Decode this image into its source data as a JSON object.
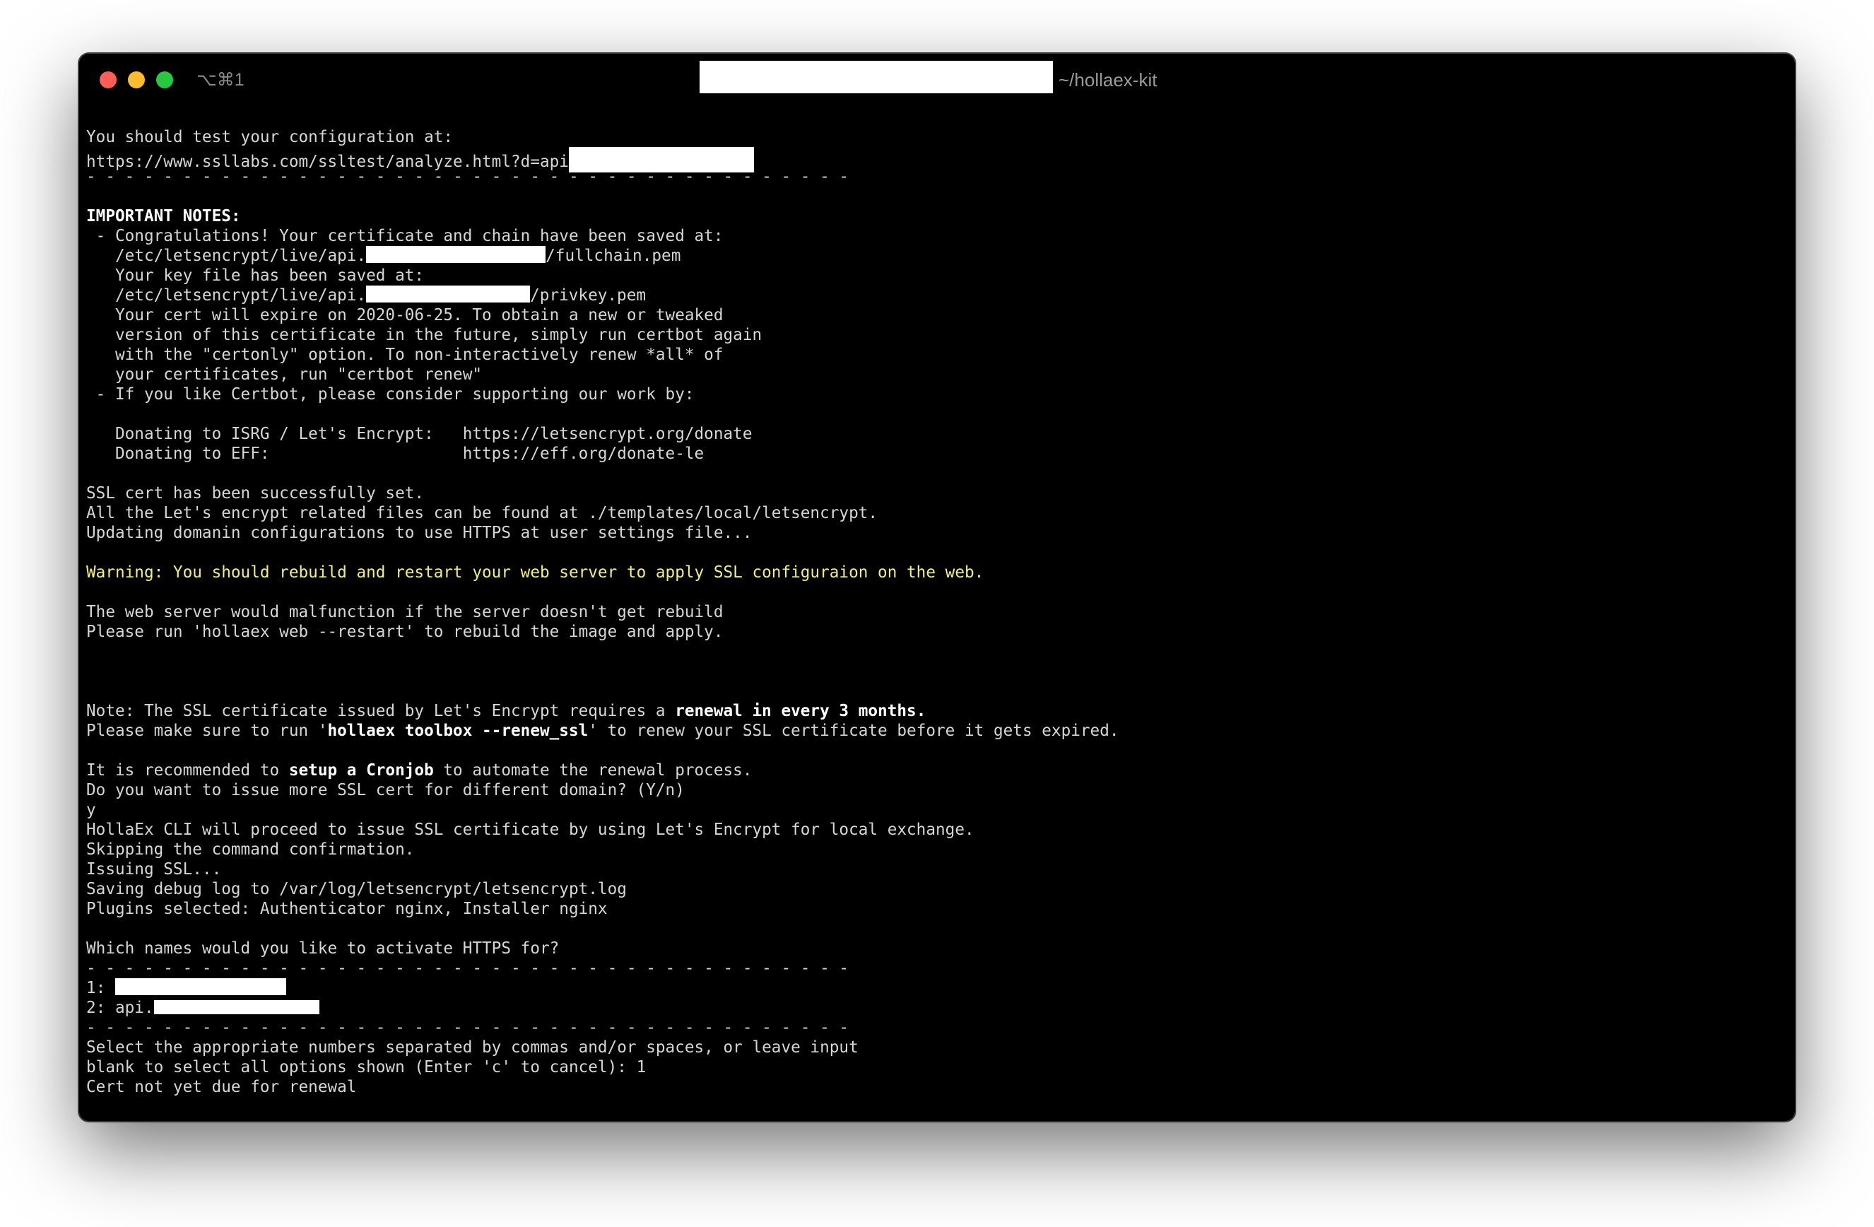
{
  "window": {
    "shortcut": "⌥⌘1",
    "title": "~/hollaex-kit"
  },
  "terminal": {
    "test_intro": "You should test your configuration at:",
    "test_url_prefix": "https://www.ssllabs.com/ssltest/analyze.html?d=api",
    "separator": "- - - - - - - - - - - - - - - - - - - - - - - - - - - - - - - - - - - - - - - -",
    "important": "IMPORTANT NOTES:",
    "congrats": " - Congratulations! Your certificate and chain have been saved at:",
    "path1_prefix": "   /etc/letsencrypt/live/api.",
    "path1_suffix": "/fullchain.pem",
    "key_saved": "   Your key file has been saved at:",
    "path2_prefix": "   /etc/letsencrypt/live/api.",
    "path2_suffix": "/privkey.pem",
    "expire_1": "   Your cert will expire on 2020-06-25. To obtain a new or tweaked",
    "expire_2": "   version of this certificate in the future, simply run certbot again",
    "expire_3": "   with the \"certonly\" option. To non-interactively renew *all* of",
    "expire_4": "   your certificates, run \"certbot renew\"",
    "support": " - If you like Certbot, please consider supporting our work by:",
    "donate_isrg": "   Donating to ISRG / Let's Encrypt:   https://letsencrypt.org/donate",
    "donate_eff": "   Donating to EFF:                    https://eff.org/donate-le",
    "ssl_set": "SSL cert has been successfully set.",
    "files_found": "All the Let's encrypt related files can be found at ./templates/local/letsencrypt.",
    "updating": "Updating domanin configurations to use HTTPS at user settings file...",
    "warning": "Warning: You should rebuild and restart your web server to apply SSL configuraion on the web.",
    "malfunction": "The web server would malfunction if the server doesn't get rebuild",
    "please_run": "Please run 'hollaex web --restart' to rebuild the image and apply.",
    "note_a": "Note: The SSL certificate issued by Let's Encrypt requires a ",
    "note_b": "renewal in every 3 months",
    "note_c": ".",
    "make_sure_a": "Please make sure to run '",
    "make_sure_b": "hollaex toolbox --renew_ssl",
    "make_sure_c": "' to renew your SSL certificate before it gets expired.",
    "recommend_a": "It is recommended to ",
    "recommend_b": "setup a Cronjob",
    "recommend_c": " to automate the renewal process.",
    "ask_more": "Do you want to issue more SSL cert for different domain? (Y/n)",
    "answer": "y",
    "proceed": "HollaEx CLI will proceed to issue SSL certificate by using Let's Encrypt for local exchange.",
    "skipping": "Skipping the command confirmation.",
    "issuing": "Issuing SSL...",
    "saving_log": "Saving debug log to /var/log/letsencrypt/letsencrypt.log",
    "plugins": "Plugins selected: Authenticator nginx, Installer nginx",
    "which_names": "Which names would you like to activate HTTPS for?",
    "opt1_prefix": "1: ",
    "opt2_prefix": "2: api.",
    "select_1": "Select the appropriate numbers separated by commas and/or spaces, or leave input",
    "select_2": "blank to select all options shown (Enter 'c' to cancel): 1",
    "not_due": "Cert not yet due for renewal"
  },
  "colors": {
    "background": "#000000",
    "text": "#d6d6d6",
    "warning": "#f2f07c",
    "close": "#ff5f57",
    "minimize": "#febc2e",
    "maximize": "#28c840"
  }
}
